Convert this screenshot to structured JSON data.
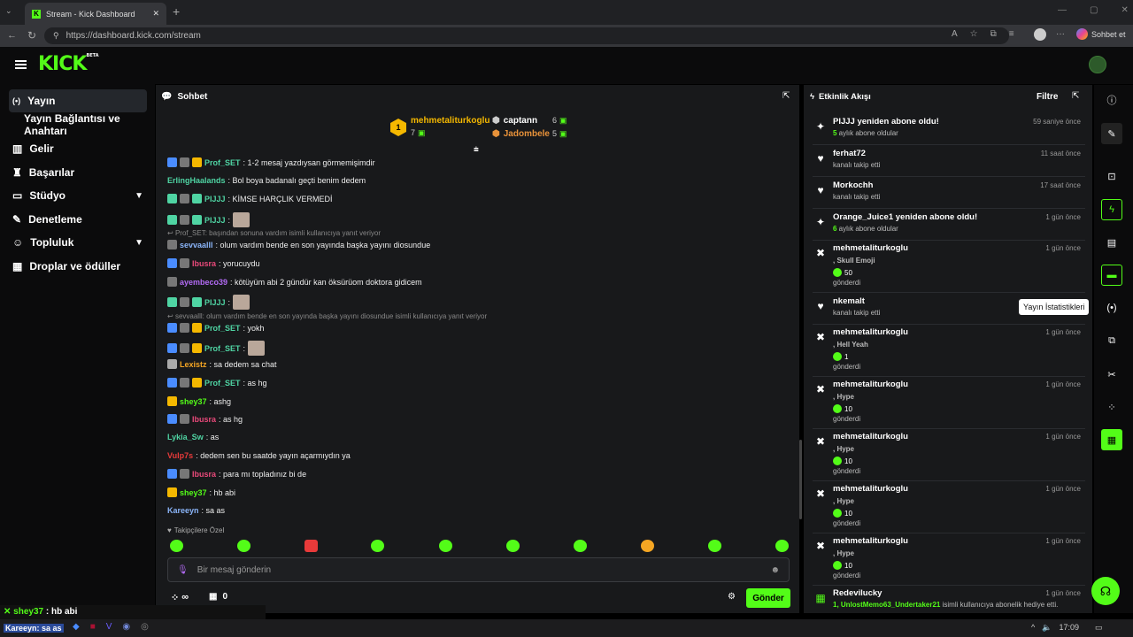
{
  "browser": {
    "tab_title": "Stream - Kick Dashboard",
    "url": "https://dashboard.kick.com/stream",
    "profile_label": "Sohbet et"
  },
  "header": {
    "logo": "KICK",
    "logo_badge": "BETA"
  },
  "sidebar": {
    "items": [
      {
        "label": "Yayın",
        "icon": "broadcast-icon"
      },
      {
        "label": "Yayın Bağlantısı ve Anahtarı"
      },
      {
        "label": "Gelir",
        "icon": "chart-icon"
      },
      {
        "label": "Başarılar",
        "icon": "trophy-icon"
      },
      {
        "label": "Stüdyo",
        "icon": "studio-icon"
      },
      {
        "label": "Denetleme",
        "icon": "wrench-icon"
      },
      {
        "label": "Topluluk",
        "icon": "users-icon"
      },
      {
        "label": "Droplar ve ödüller",
        "icon": "gift-icon"
      }
    ]
  },
  "chat": {
    "title": "Sohbet",
    "leaderboard": [
      {
        "name": "mehmetaliturkoglu",
        "count": "7",
        "rank": "1"
      },
      {
        "name": "captann",
        "count": "6"
      },
      {
        "name": "Jadombele",
        "count": "5"
      }
    ],
    "messages": [
      {
        "user": "Prof_SET",
        "text": ": 1-2 mesaj yazdıysan görmemişimdir",
        "color": "#4fd4a3"
      },
      {
        "user": "ErlingHaalands",
        "text": ": Bol boya badanalı geçti benim dedem",
        "color": "#4fd4a3"
      },
      {
        "user": "PIJJJ",
        "text": ": KİMSE HARÇLIK VERMEDİ",
        "color": "#4fd4a3"
      },
      {
        "user": "PIJJJ",
        "text": ":",
        "color": "#4fd4a3"
      },
      {
        "user": "sevvaalll",
        "text": ": olum vardım bende en son yayında başka yayını diosundue",
        "color": "#8ab4f8"
      },
      {
        "user": "Ibusra",
        "text": ": yorucuydu",
        "color": "#e8497a"
      },
      {
        "user": "ayembeco39",
        "text": ": kötüyüm abi 2 gündür kan öksürüom doktora gidicem",
        "color": "#b36bf5"
      },
      {
        "user": "PIJJJ",
        "text": ":",
        "color": "#4fd4a3"
      },
      {
        "user": "Prof_SET",
        "text": ": yokh",
        "color": "#4fd4a3"
      },
      {
        "user": "Prof_SET",
        "text": ":",
        "color": "#4fd4a3"
      },
      {
        "user": "Lexistz",
        "text": ": sa dedem sa chat",
        "color": "#f5a623"
      },
      {
        "user": "Prof_SET",
        "text": ": as hg",
        "color": "#4fd4a3"
      },
      {
        "user": "shey37",
        "text": ": ashg",
        "color": "#53fc18"
      },
      {
        "user": "Ibusra",
        "text": ": as hg",
        "color": "#e8497a"
      },
      {
        "user": "Lykia_Sw",
        "text": ": as",
        "color": "#4fd4a3"
      },
      {
        "user": "Vulp7s",
        "text": ": dedem sen bu saatde yayın açarmıydın ya",
        "color": "#e83a3a"
      },
      {
        "user": "Ibusra",
        "text": ": para mı topladınız bi de",
        "color": "#e8497a"
      },
      {
        "user": "shey37",
        "text": ": hb abi",
        "color": "#53fc18"
      },
      {
        "user": "Kareeyn",
        "text": ": sa as",
        "color": "#8ab4f8"
      }
    ],
    "replies": [
      "Prof_SET: başından sonuna vardım isimli kullanıcıya yanıt veriyor",
      "sevvaalll: olum vardım bende en son yayında başka yayını diosundue isimli kullanıcıya yanıt veriyor"
    ],
    "followers_only": "Takipçilere Özel",
    "input_placeholder": "Bir mesaj gönderin",
    "infinity": "∞",
    "gift_count": "0",
    "send_label": "Gönder"
  },
  "activity": {
    "title": "Etkinlik Akışı",
    "filter_label": "Filtre",
    "events": [
      {
        "title": "PIJJJ yeniden abone oldu!",
        "time": "59 saniye önce",
        "sub_highlight": "5",
        "sub": " aylık abone oldular",
        "icon": "sparkle-icon"
      },
      {
        "title": "ferhat72",
        "time": "11 saat önce",
        "sub": "kanalı takip etti",
        "icon": "heart-icon"
      },
      {
        "title": "Morkochh",
        "time": "17 saat önce",
        "sub": "kanalı takip etti",
        "icon": "heart-icon"
      },
      {
        "title": "Orange_Juice1 yeniden abone oldu!",
        "time": "1 gün önce",
        "sub_highlight": "6",
        "sub": " aylık abone oldular",
        "icon": "sparkle-icon"
      },
      {
        "title": "mehmetaliturkoglu",
        "time": "1 gün önce",
        "item": ", Skull Emoji",
        "amount": "50",
        "sent": "gönderdi",
        "icon": "kick-icon"
      },
      {
        "title": "nkemalt",
        "time": "",
        "sub": "kanalı takip etti",
        "icon": "heart-icon"
      },
      {
        "title": "mehmetaliturkoglu",
        "time": "1 gün önce",
        "item": ", Hell Yeah",
        "amount": "1",
        "sent": "gönderdi",
        "icon": "kick-icon"
      },
      {
        "title": "mehmetaliturkoglu",
        "time": "1 gün önce",
        "item": ", Hype",
        "amount": "10",
        "sent": "gönderdi",
        "icon": "kick-icon"
      },
      {
        "title": "mehmetaliturkoglu",
        "time": "1 gün önce",
        "item": ", Hype",
        "amount": "10",
        "sent": "gönderdi",
        "icon": "kick-icon"
      },
      {
        "title": "mehmetaliturkoglu",
        "time": "1 gün önce",
        "item": ", Hype",
        "amount": "10",
        "sent": "gönderdi",
        "icon": "kick-icon"
      },
      {
        "title": "mehmetaliturkoglu",
        "time": "1 gün önce",
        "item": ", Hype",
        "amount": "10",
        "sent": "gönderdi",
        "icon": "kick-icon"
      },
      {
        "title": "Redevilucky",
        "time": "1 gün önce",
        "sub_highlight": "1, UnlostMemo63_Undertaker21",
        "sub": " isimli kullanıcıya abonelik hediye etti.",
        "icon": "gift-icon"
      }
    ]
  },
  "rail": {
    "tooltip": "Yayın İstatistikleri"
  },
  "overlay": {
    "user": "shey37",
    "text": " : hb abi",
    "user2": "Kareeyn",
    "text2": ": sa as"
  },
  "taskbar": {
    "time": "17:09"
  },
  "colors": {
    "accent": "#53fc18",
    "panel": "#18191b",
    "bg": "#000000"
  }
}
